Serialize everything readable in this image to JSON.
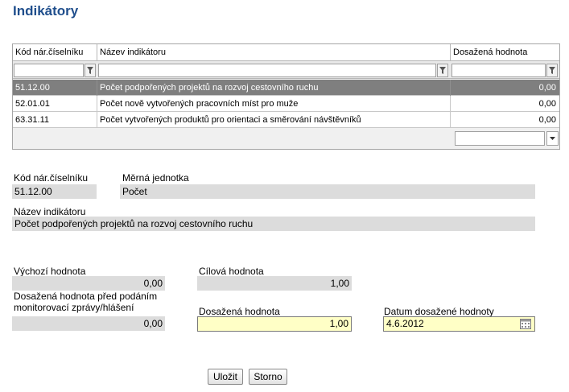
{
  "page": {
    "title": "Indikátory"
  },
  "grid": {
    "columns": [
      "Kód nár.číselníku",
      "Název indikátoru",
      "Dosažená hodnota"
    ],
    "rows": [
      {
        "code": "51.12.00",
        "name": "Počet podpořených projektů na rozvoj cestovního ruchu",
        "value": "0,00",
        "selected": true
      },
      {
        "code": "52.01.01",
        "name": "Počet nově vytvořených pracovních míst pro muže",
        "value": "0,00",
        "selected": false
      },
      {
        "code": "63.31.11",
        "name": "Počet vytvořených produktů pro orientaci a směrování návštěvníků",
        "value": "0,00",
        "selected": false
      }
    ],
    "filter_icon": "funnel-icon",
    "pager_icon": "chevron-down-icon"
  },
  "detail": {
    "code_label": "Kód nár.číselníku",
    "code_value": "51.12.00",
    "unit_label": "Měrná jednotka",
    "unit_value": "Počet",
    "name_label": "Název indikátoru",
    "name_value": "Počet podpořených projektů na rozvoj cestovního ruchu",
    "initial_label": "Výchozí hodnota",
    "initial_value": "0,00",
    "target_label": "Cílová hodnota",
    "target_value": "1,00",
    "before_report_label_1": "Dosažená hodnota před podáním",
    "before_report_label_2": "monitorovací zprávy/hlášení",
    "before_report_value": "0,00",
    "achieved_label": "Dosažená hodnota",
    "achieved_value": "1,00",
    "date_label": "Datum dosažené hodnoty",
    "date_value": "4.6.2012",
    "calendar_icon": "calendar-icon"
  },
  "buttons": {
    "save": "Uložit",
    "cancel": "Storno"
  },
  "colors": {
    "title": "#1f4e8c",
    "selected_row": "#7f7f7f",
    "editable_field": "#ffffc6",
    "readonly_field": "#dcdcdc"
  }
}
